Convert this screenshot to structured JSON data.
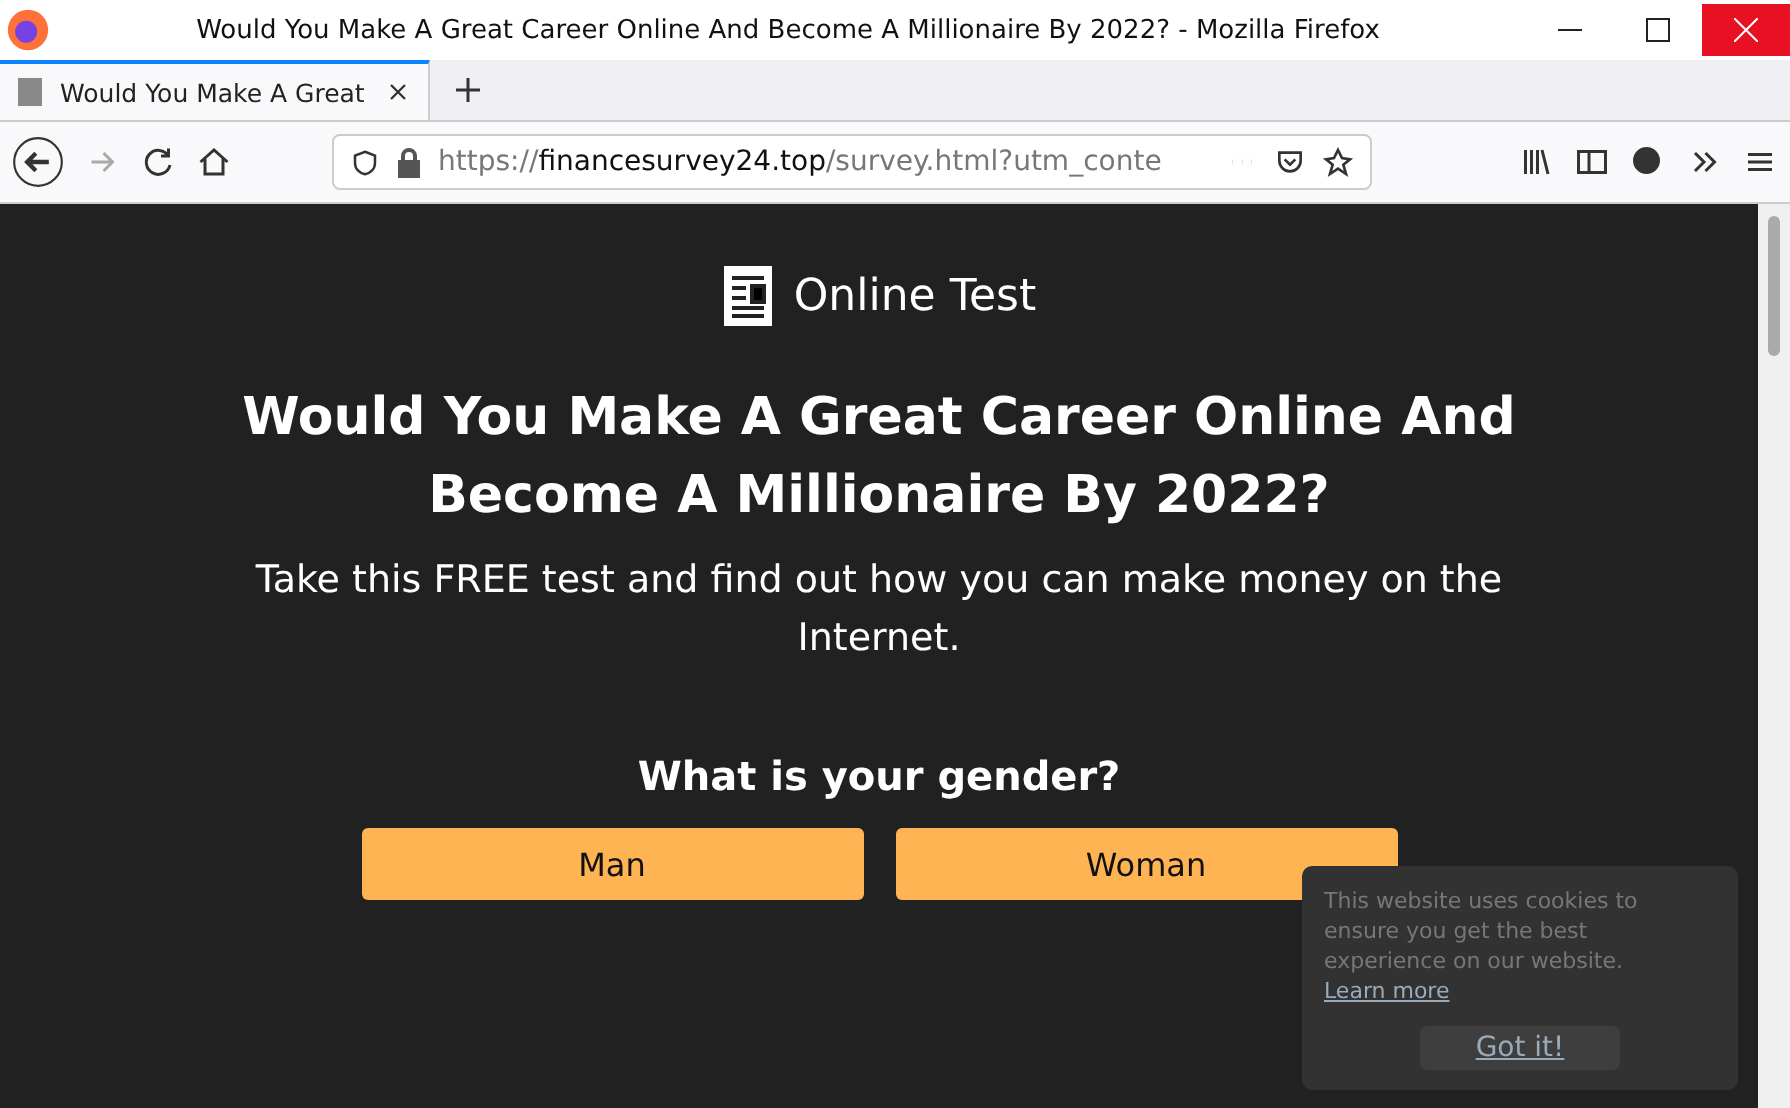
{
  "window": {
    "title": "Would You Make A Great Career Online And Become A Millionaire By 2022? - Mozilla Firefox"
  },
  "tabs": [
    {
      "label": "Would You Make A Great",
      "selected": true
    }
  ],
  "address": {
    "scheme": "https://",
    "host": "financesurvey24.top",
    "path": "/survey.html?utm_conte"
  },
  "page": {
    "brand": "Online Test",
    "headline": "Would You Make A Great Career Online And Become A Millionaire By 2022?",
    "subtitle": "Take this FREE test and find out how you can make money on the Internet.",
    "question": "What is your gender?",
    "answers": [
      "Man",
      "Woman"
    ]
  },
  "cookie_notice": {
    "text": "This website uses cookies to ensure you get the best experience on our website.",
    "link": "Learn more",
    "button": "Got it!"
  }
}
